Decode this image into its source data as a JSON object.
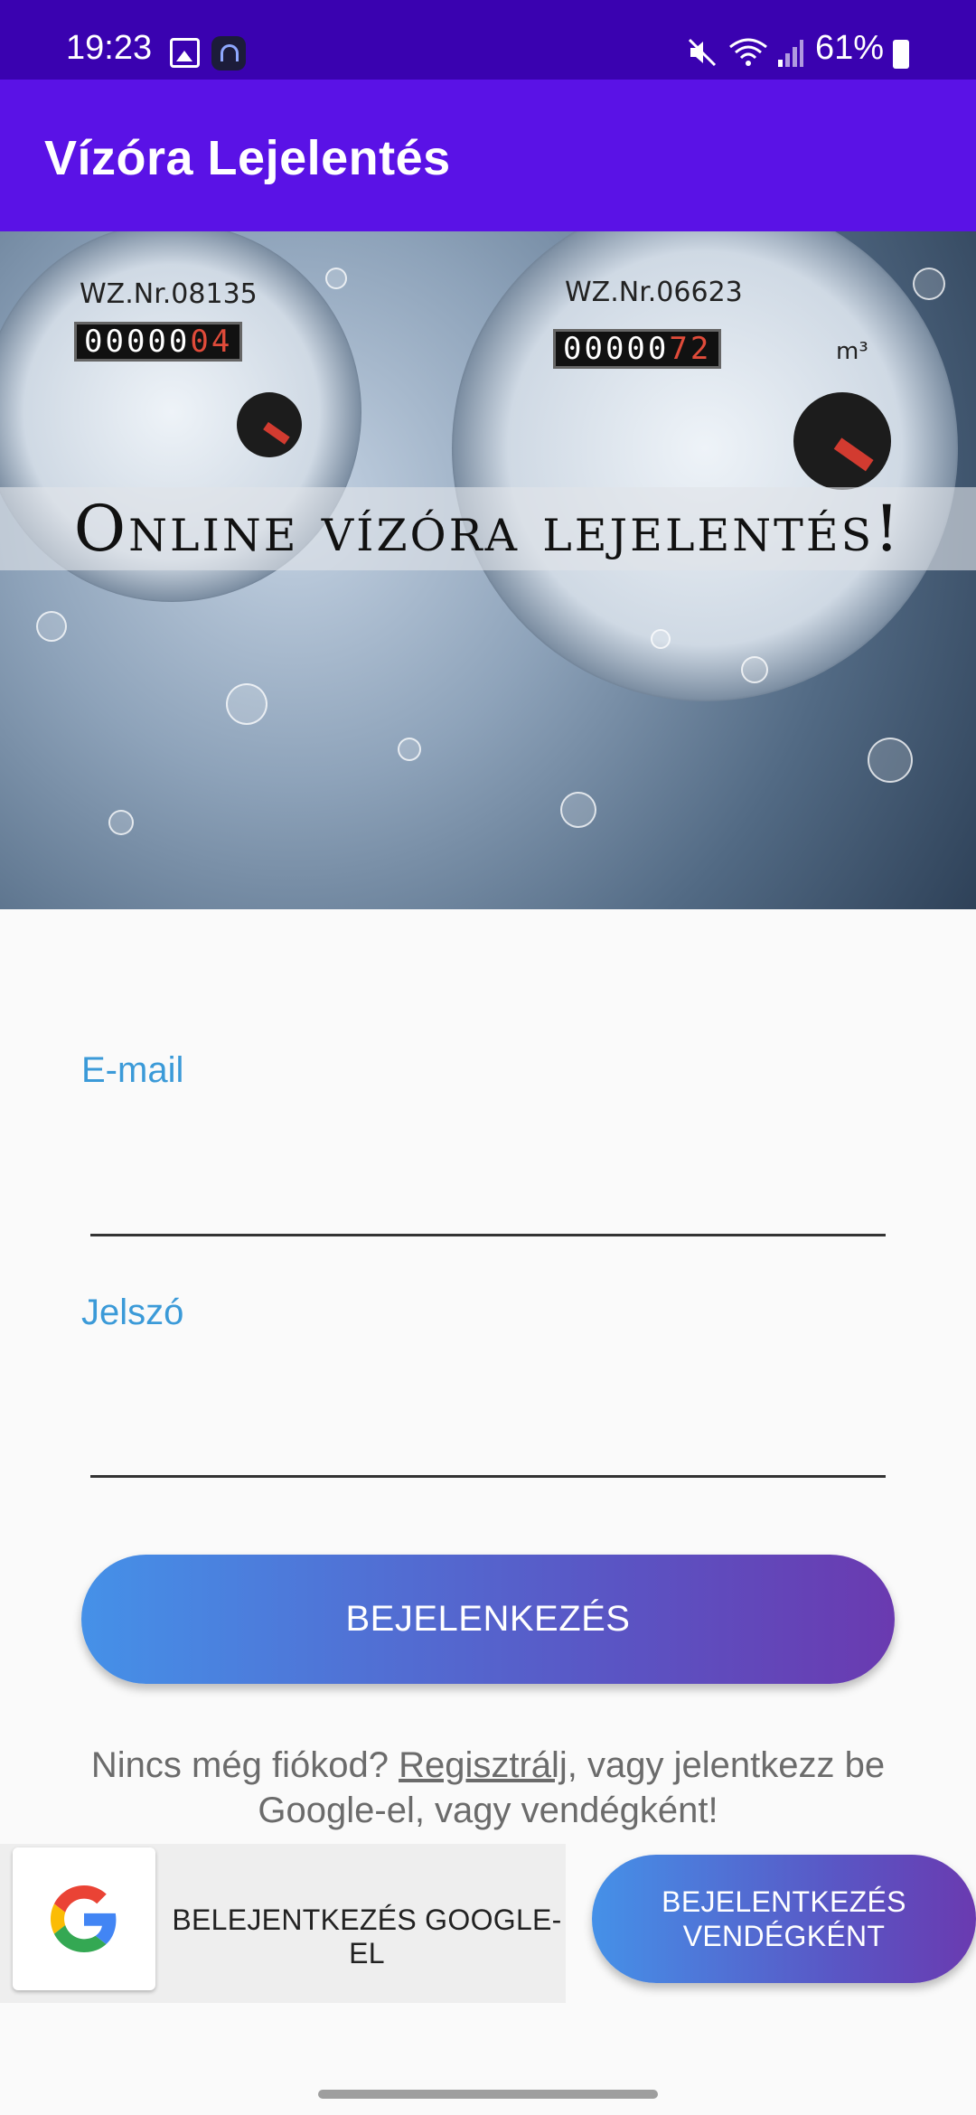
{
  "status_bar": {
    "time": "19:23",
    "battery_percent": "61%",
    "icons": [
      "image-icon",
      "headphones-app-icon",
      "mute-icon",
      "wifi-icon",
      "signal-icon",
      "battery-charging-icon"
    ]
  },
  "app_bar": {
    "title": "Vízóra Lejelentés",
    "color": "#5a12e6"
  },
  "hero": {
    "banner_text": "Online vízóra lejelentés!",
    "meter_left_serial": "WZ.Nr.08135",
    "meter_left_reading": "00000",
    "meter_left_reading_red": "04",
    "meter_right_serial": "WZ.Nr.06623",
    "meter_right_reading": "00000",
    "meter_right_reading_red": "72",
    "meter_right_unit": "m³"
  },
  "form": {
    "email_label": "E-mail",
    "email_value": "",
    "password_label": "Jelszó",
    "password_value": "",
    "login_button": "BEJELENKEZÉS"
  },
  "register": {
    "prefix": "Nincs még fiókod? ",
    "link": "Regisztrálj",
    "suffix": ", vagy jelentkezz be Google-el, vagy vendégként!"
  },
  "bottom": {
    "google_button": "BELEJENTKEZÉS GOOGLE-EL",
    "guest_button": "BEJELENTKEZÉS\nVENDÉGKÉNT"
  },
  "colors": {
    "status_bar": "#3a02b0",
    "accent_label": "#3b9ad8",
    "gradient_start": "#4591e8",
    "gradient_end": "#6a3ab0"
  }
}
